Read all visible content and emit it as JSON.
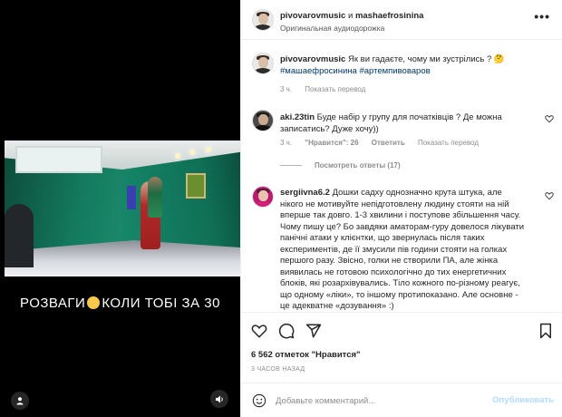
{
  "media": {
    "caption_left": "РОЗВАГИ",
    "caption_right": "КОЛИ ТОБІ ЗА 30",
    "caption_emoji": "smiling-face-icon",
    "user_tag_icon": "user-icon",
    "mute_icon": "speaker-icon"
  },
  "header": {
    "user1": "pivovarovmusic",
    "joiner": "и",
    "user2": "mashaefrosinina",
    "subtitle": "Оригинальная аудиодорожка",
    "more_label": "•••"
  },
  "post_caption": {
    "user": "pivovarovmusic",
    "text": "Як ви гадаєте, чому ми зустрілись ? 🤔",
    "tags": "#машаефросинина #артемпивоваров",
    "time": "3 ч.",
    "translate": "Показать перевод"
  },
  "comments": [
    {
      "user": "aki.23tin",
      "text": "Буде набір у групу для початківців ? Де можна записатись? Дуже хочу))",
      "time": "3 ч.",
      "likes": "\"Нравится\": 26",
      "reply": "Ответить",
      "translate": "Показать перевод",
      "view_replies": "Посмотреть ответы (17)"
    },
    {
      "user": "sergiivna6.2",
      "text": "Дошки садху однозначно крута штука, але нікого не мотивуйте непідготовлену людину стояти на ній вперше так довго. 1-3 хвилини і поступове збільшення часу. Чому пишу це? Бо завдяки аматорам-гуру довелося лікувати панічні атаки у клієнтки, що звернулась після таких експериментів, де її змусили пів години стояти на голках першого разу. Звісно, голки не створили ПА, але жінка виявилась не готовою психологічно до тих енергетичних блоків, які розархівувались. Тіло кожного по-різному реагує, що одному «ліки», то іншому протипоказано. Але основне - це адекватне «дозування» :)"
    }
  ],
  "actions": {
    "like_icon": "heart-icon",
    "comment_icon": "comment-icon",
    "share_icon": "paper-plane-icon",
    "save_icon": "bookmark-icon"
  },
  "likes_text": "6 562 отметок \"Нравится\"",
  "timestamp": "3 ЧАСОВ НАЗАД",
  "comment_bar": {
    "placeholder": "Добавьте комментарий...",
    "publish": "Опубликовать"
  },
  "colors": {
    "link": "#00376b",
    "muted": "#8e8e8e",
    "publish_disabled": "#b3dbff",
    "wall_green": "#137a5e"
  }
}
